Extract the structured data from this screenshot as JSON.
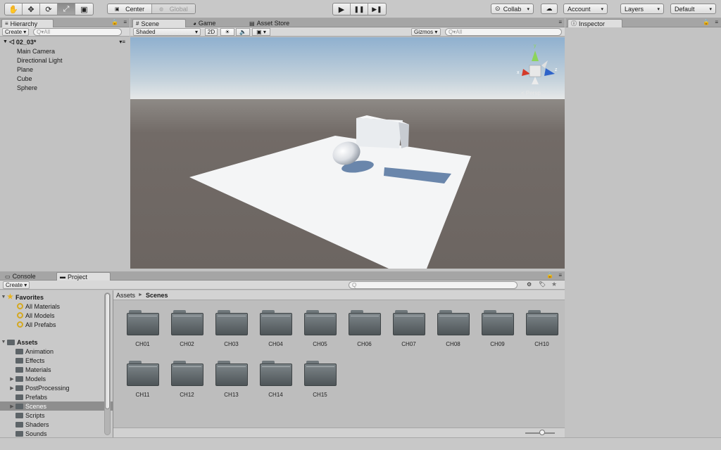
{
  "toolbar": {
    "tools": [
      {
        "name": "hand-tool",
        "glyph": "✋"
      },
      {
        "name": "move-tool",
        "glyph": "✥"
      },
      {
        "name": "rotate-tool",
        "glyph": "⟳"
      },
      {
        "name": "scale-tool",
        "glyph": "⤢"
      },
      {
        "name": "rect-tool",
        "glyph": "▣"
      }
    ],
    "active_tool_index": 3,
    "pivot_label": "Center",
    "space_label": "Global",
    "play_glyph": "▶",
    "pause_glyph": "❚❚",
    "step_glyph": "▶❚",
    "collab_label": "Collab",
    "collab_caret": "▾",
    "cloud_glyph": "☁",
    "account_label": "Account",
    "layers_label": "Layers",
    "layout_label": "Default",
    "caret": "▾"
  },
  "hierarchy": {
    "tab_label": "Hierarchy",
    "create_label": "Create",
    "search_placeholder": "Q▾All",
    "scene_name": "02_03*",
    "items": [
      "Main Camera",
      "Directional Light",
      "Plane",
      "Cube",
      "Sphere"
    ]
  },
  "center_tabs": {
    "scene_label": "Scene",
    "game_label": "Game",
    "asset_store_label": "Asset Store"
  },
  "scene": {
    "shading_label": "Shaded",
    "mode_2d_label": "2D",
    "lighting_glyph": "☀",
    "audio_glyph": "🔈",
    "fx_glyph": "▣",
    "gizmos_label": "Gizmos",
    "search_placeholder": "Q▾All",
    "axis_x": "x",
    "axis_y": "y",
    "axis_z": "z",
    "view_label": "< Persp"
  },
  "inspector": {
    "tab_label": "Inspector"
  },
  "bottom_tabs": {
    "console_label": "Console",
    "project_label": "Project"
  },
  "project": {
    "create_label": "Create",
    "search_placeholder": "Q",
    "favorites_label": "Favorites",
    "favorites": [
      "All Materials",
      "All Models",
      "All Prefabs"
    ],
    "assets_label": "Assets",
    "asset_folders": [
      {
        "label": "Animation",
        "expandable": false,
        "selected": false
      },
      {
        "label": "Effects",
        "expandable": false,
        "selected": false
      },
      {
        "label": "Materials",
        "expandable": false,
        "selected": false
      },
      {
        "label": "Models",
        "expandable": true,
        "selected": false
      },
      {
        "label": "PostProcessing",
        "expandable": true,
        "selected": false
      },
      {
        "label": "Prefabs",
        "expandable": false,
        "selected": false
      },
      {
        "label": "Scenes",
        "expandable": true,
        "selected": true
      },
      {
        "label": "Scripts",
        "expandable": false,
        "selected": false
      },
      {
        "label": "Shaders",
        "expandable": false,
        "selected": false
      },
      {
        "label": "Sounds",
        "expandable": false,
        "selected": false
      }
    ],
    "breadcrumb_root": "Assets",
    "breadcrumb_current": "Scenes",
    "breadcrumb_sep": "►",
    "scene_folders": [
      "CH01",
      "CH02",
      "CH03",
      "CH04",
      "CH05",
      "CH06",
      "CH07",
      "CH08",
      "CH09",
      "CH10",
      "CH11",
      "CH12",
      "CH13",
      "CH14",
      "CH15"
    ]
  }
}
